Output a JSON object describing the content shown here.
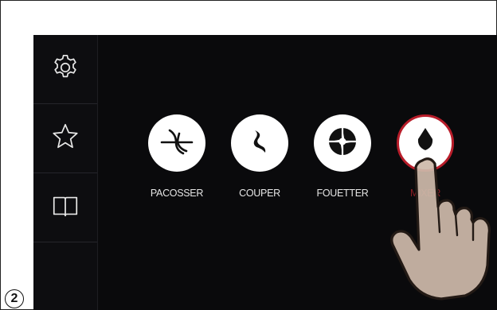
{
  "sidebar": {
    "items": [
      {
        "icon": "gear-icon"
      },
      {
        "icon": "star-icon"
      },
      {
        "icon": "book-icon"
      }
    ]
  },
  "tools": [
    {
      "label": "PACOSSER",
      "icon": "kneading-hook-icon"
    },
    {
      "label": "COUPER",
      "icon": "cutting-blade-icon"
    },
    {
      "label": "FOUETTER",
      "icon": "whisk-icon"
    },
    {
      "label": "MIXER",
      "icon": "mixer-blade-icon",
      "selected": true
    }
  ],
  "step": {
    "number": "2"
  },
  "colors": {
    "background": "#0a0a0c",
    "accent": "#b81d2a",
    "button": "#ffffff",
    "hand": "#cdb9aa"
  }
}
